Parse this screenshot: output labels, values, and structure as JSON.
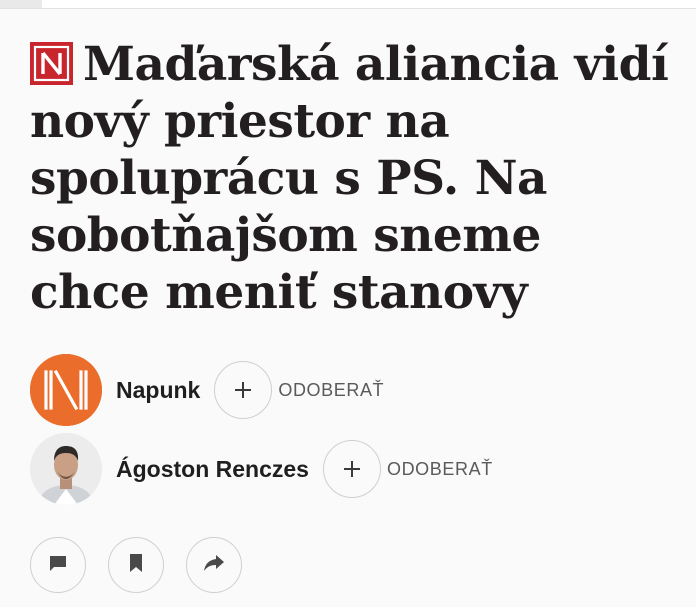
{
  "article": {
    "title": "Maďarská aliancia vidí nový priestor na spoluprácu s PS. Na sobotňajšom sneme chce meniť stanovy",
    "brand_logo_icon": "n-logo-icon"
  },
  "authors": [
    {
      "name": "Napunk",
      "avatar": "napunk-logo-avatar",
      "follow_label": "ODOBERAŤ",
      "follow_icon": "plus-icon"
    },
    {
      "name": "Ágoston Renczes",
      "avatar": "author-photo-avatar",
      "follow_label": "ODOBERAŤ",
      "follow_icon": "plus-icon"
    }
  ],
  "actions": [
    {
      "icon": "comment-icon"
    },
    {
      "icon": "bookmark-icon"
    },
    {
      "icon": "share-icon"
    }
  ],
  "colors": {
    "logo_red": "#c8252d",
    "napunk_orange": "#ea6d2c",
    "text": "#231f20",
    "muted": "#5a5a5a",
    "border": "#cfcfcf"
  }
}
